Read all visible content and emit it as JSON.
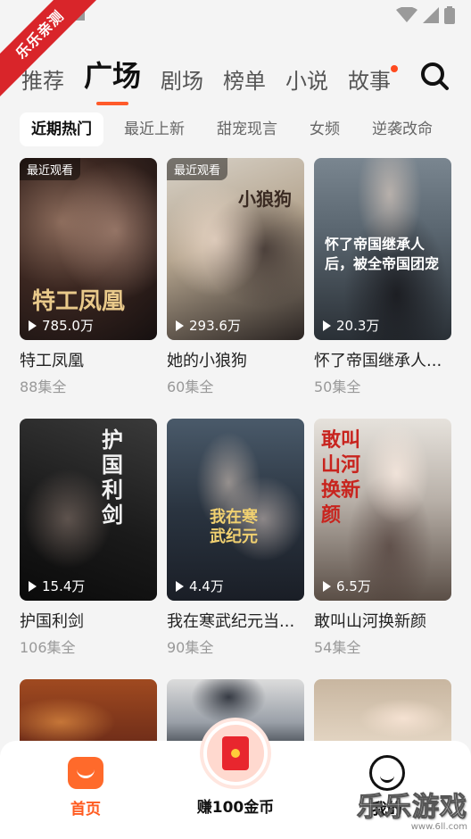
{
  "ribbon": {
    "text": "乐乐亲测"
  },
  "tabs": [
    {
      "label": "推荐"
    },
    {
      "label": "广场"
    },
    {
      "label": "剧场"
    },
    {
      "label": "榜单"
    },
    {
      "label": "小说"
    },
    {
      "label": "故事"
    }
  ],
  "sub_tabs": [
    {
      "label": "近期热门"
    },
    {
      "label": "最近上新"
    },
    {
      "label": "甜宠现言"
    },
    {
      "label": "女频"
    },
    {
      "label": "逆袭改命"
    }
  ],
  "cards": [
    {
      "title": "特工凤凰",
      "episodes": "88集全",
      "views": "785.0万",
      "label": "最近观看",
      "art_text": "特工凤凰"
    },
    {
      "title": "她的小狼狗",
      "episodes": "60集全",
      "views": "293.6万",
      "label": "最近观看",
      "art_text": "小狼狗"
    },
    {
      "title": "怀了帝国继承人...",
      "episodes": "50集全",
      "views": "20.3万",
      "label": "",
      "art_text": "怀了帝国继承人后，被全帝国团宠"
    },
    {
      "title": "护国利剑",
      "episodes": "106集全",
      "views": "15.4万",
      "label": "",
      "art_text": "护国利剑"
    },
    {
      "title": "我在寒武纪元当...",
      "episodes": "90集全",
      "views": "4.4万",
      "label": "",
      "art_text": "我在寒武纪元"
    },
    {
      "title": "敢叫山河换新颜",
      "episodes": "54集全",
      "views": "6.5万",
      "label": "",
      "art_text": "敢叫山河换新颜"
    }
  ],
  "nav": {
    "home": "首页",
    "coin": "赚100金币",
    "me": "我的"
  },
  "watermark": {
    "brand": "乐乐游戏",
    "url": "www.6ll.com"
  },
  "colors": {
    "accent": "#ff5a2a",
    "background": "#f4f4f4"
  }
}
